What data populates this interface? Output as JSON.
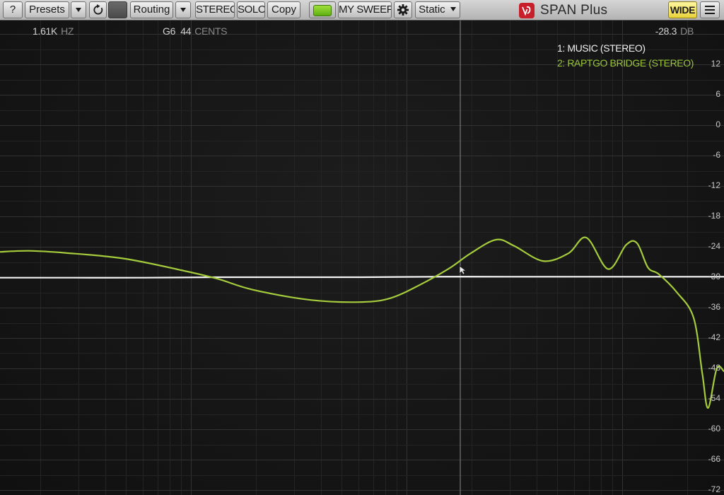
{
  "toolbar": {
    "help_label": "?",
    "presets_label": "Presets",
    "routing_label": "Routing",
    "stereo_label": "STEREO",
    "solo_label": "SOLO",
    "copy_label": "Copy",
    "sweep_label": "MY SWEEP",
    "static_label": "Static",
    "brand_name": "SPAN Plus",
    "wide_label": "WIDE"
  },
  "icons": {
    "dropdown": "triangle-down-icon",
    "reset": "reset-icon",
    "settings": "gear-icon",
    "menu": "hamburger-menu-icon",
    "logo": "voxengo-logo-icon"
  },
  "readouts": {
    "freq_value": "1.61K",
    "freq_unit": "HZ",
    "note_value": "G6",
    "cents_value": "44",
    "cents_unit": "CENTS",
    "level_value": "-28.3",
    "level_unit": "DB"
  },
  "legend": {
    "item1": "1: MUSIC (STEREO)",
    "item2": "2: RAPTGO BRIDGE (STEREO)"
  },
  "colors": {
    "series1": "#f4f4f4",
    "series2": "#a5cc3c",
    "grid": "#2e2e2e",
    "background": "#161616",
    "wide_button": "#f3e04a",
    "led": "#7cc520"
  },
  "chart_data": {
    "type": "line",
    "xlim_fraction": [
      0,
      1
    ],
    "ylim": [
      -72,
      18
    ],
    "yticks": [
      12,
      6,
      0,
      -6,
      -12,
      -18,
      -24,
      -30,
      -36,
      -42,
      -48,
      -54,
      -60,
      -66,
      -72
    ],
    "ytick_labels": [
      "12",
      "6",
      "0",
      "-6",
      "-12",
      "-18",
      "-24",
      "-30",
      "-36",
      "-42",
      "-48",
      "-54",
      "-60",
      "-66",
      "-72"
    ],
    "series": [
      {
        "name": "1: MUSIC (STEREO)",
        "x": [
          0,
          0.1,
          0.2,
          0.3,
          0.4,
          0.5,
          0.6,
          0.7,
          0.8,
          0.9,
          1.0
        ],
        "y": [
          -30.1,
          -30.1,
          -30.1,
          -30.0,
          -30.0,
          -30.0,
          -29.9,
          -29.9,
          -29.9,
          -29.9,
          -29.9
        ]
      },
      {
        "name": "2: RAPTGO BRIDGE (STEREO)",
        "x": [
          0,
          0.04,
          0.09,
          0.17,
          0.25,
          0.3,
          0.35,
          0.43,
          0.5,
          0.54,
          0.58,
          0.62,
          0.65,
          0.685,
          0.71,
          0.75,
          0.785,
          0.81,
          0.84,
          0.865,
          0.88,
          0.895,
          0.91,
          0.935,
          0.958,
          0.97,
          0.978,
          0.99,
          1.0
        ],
        "y": [
          -25.0,
          -24.8,
          -25.2,
          -26.3,
          -28.6,
          -30.3,
          -32.5,
          -34.5,
          -34.9,
          -34.1,
          -31.5,
          -28.3,
          -25.3,
          -22.6,
          -23.8,
          -26.8,
          -25.3,
          -22.2,
          -28.4,
          -23.6,
          -23.3,
          -28.1,
          -29.4,
          -33.0,
          -38.0,
          -49.0,
          -55.8,
          -48.0,
          -48.6
        ]
      }
    ]
  }
}
